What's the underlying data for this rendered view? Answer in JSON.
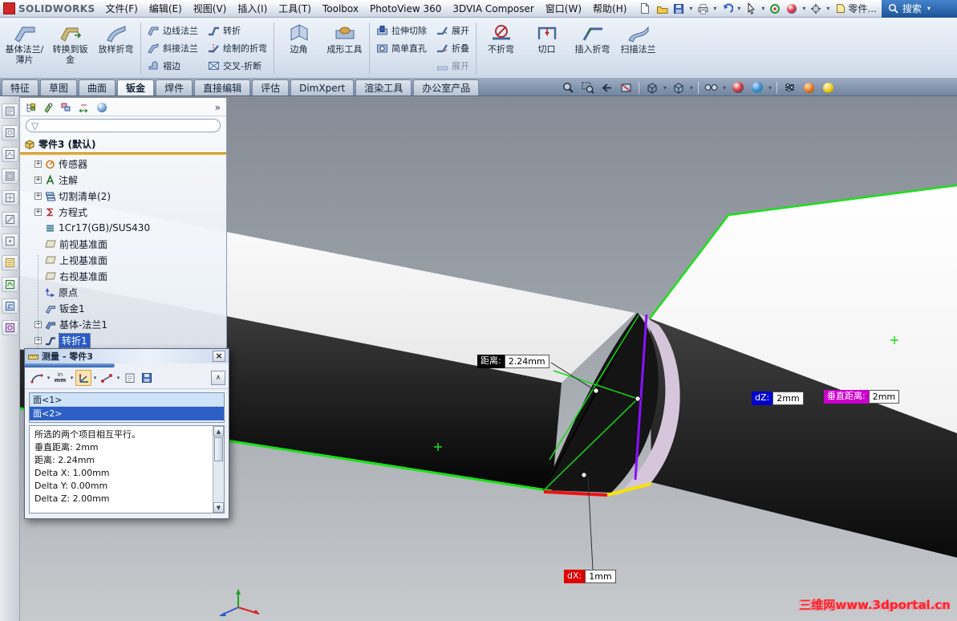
{
  "menu_bar": {
    "logo": "SOLIDWORKS",
    "items": [
      "文件(F)",
      "编辑(E)",
      "视图(V)",
      "插入(I)",
      "工具(T)",
      "Toolbox",
      "PhotoView 360",
      "3DVIA Composer",
      "窗口(W)",
      "帮助(H)"
    ],
    "doc_title": "零件...",
    "search_label": "搜索"
  },
  "ribbon": {
    "groups": [
      {
        "buttons": [
          "基体法兰/薄片",
          "转换到钣金",
          "放样折弯"
        ]
      },
      {
        "buttons": [
          "边线法兰",
          "斜接法兰",
          "褶边"
        ]
      },
      {
        "buttons": [
          "转折",
          "绘制的折弯",
          "交叉-折断"
        ]
      },
      {
        "buttons": [
          "边角"
        ]
      },
      {
        "buttons": [
          "成形工具"
        ]
      },
      {
        "buttons": [
          "拉伸切除",
          "简单直孔"
        ]
      },
      {
        "buttons": [
          "展开",
          "折叠",
          "展开"
        ]
      },
      {
        "buttons": [
          "不折弯"
        ]
      },
      {
        "buttons": [
          "切口"
        ]
      },
      {
        "buttons": [
          "插入折弯"
        ]
      },
      {
        "buttons": [
          "扫描法兰"
        ]
      }
    ]
  },
  "tabs": {
    "items": [
      "特征",
      "草图",
      "曲面",
      "钣金",
      "焊件",
      "直接编辑",
      "评估",
      "DimXpert",
      "渲染工具",
      "办公室产品"
    ],
    "active": "钣金"
  },
  "feature_tree": {
    "root": "零件3 (默认)",
    "items": [
      {
        "label": "传感器"
      },
      {
        "label": "注解"
      },
      {
        "label": "切割清单(2)"
      },
      {
        "label": "方程式"
      },
      {
        "label": "1Cr17(GB)/SUS430"
      },
      {
        "label": "前视基准面"
      },
      {
        "label": "上视基准面"
      },
      {
        "label": "右视基准面"
      },
      {
        "label": "原点"
      },
      {
        "label": "钣金1"
      },
      {
        "label": "基体-法兰1"
      },
      {
        "label": "转折1",
        "selected": true
      }
    ]
  },
  "measure_dialog": {
    "title": "测量 - 零件3",
    "units_top": "in",
    "units_bottom": "mm",
    "selections": [
      "面<1>",
      "面<2>"
    ],
    "result_lines": [
      "所选的两个项目相互平行。",
      "垂直距离: 2mm",
      "距离: 2.24mm",
      "Delta X: 1.00mm",
      "Delta Y: 0.00mm",
      "Delta Z: 2.00mm"
    ]
  },
  "viewport": {
    "callouts": {
      "distance": {
        "label": "距离:",
        "value": "2.24mm"
      },
      "dz": {
        "label": "dZ:",
        "value": "2mm"
      },
      "vertical": {
        "label": "垂直距离:",
        "value": "2mm"
      },
      "dx": {
        "label": "dX:",
        "value": "1mm"
      }
    },
    "watermark": "三维网www.3dportal.cn"
  },
  "icons": {
    "expand_plus": "+",
    "close": "×",
    "dropdown": "▾",
    "double_chevron": "»",
    "filter_funnel": "▽",
    "collapse_chevron": "∧",
    "scroll_up": "▲",
    "scroll_down": "▼"
  },
  "colors": {
    "selection_green": "#1ae01a",
    "jog_edge_purple": "#8a10ff",
    "axis_red": "#ee1111",
    "axis_yellow": "#f5e20a",
    "dz_label_blue": "#0000cc",
    "vertical_label_magenta": "#cc00cc",
    "dx_label_red": "#e00000",
    "distance_label_black": "#000000"
  }
}
